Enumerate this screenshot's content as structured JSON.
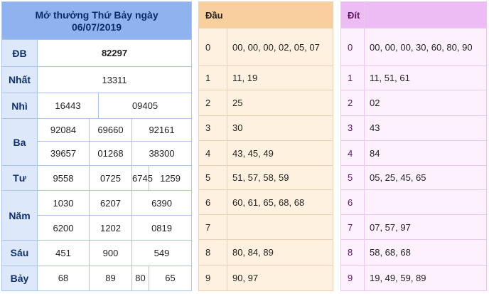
{
  "results": {
    "title_line1": "Mở thưởng Thứ Bảy ngày",
    "title_line2": "06/07/2019",
    "prizes": {
      "db": {
        "label": "ĐB",
        "values": [
          "82297"
        ]
      },
      "nhat": {
        "label": "Nhất",
        "values": [
          "13311"
        ]
      },
      "nhi": {
        "label": "Nhì",
        "values": [
          "16443",
          "09405"
        ]
      },
      "ba": {
        "label": "Ba",
        "values": [
          "92084",
          "69660",
          "92161",
          "39657",
          "01268",
          "38300"
        ]
      },
      "tu": {
        "label": "Tư",
        "values": [
          "9558",
          "0725",
          "6745",
          "1259"
        ]
      },
      "nam": {
        "label": "Năm",
        "values": [
          "1030",
          "6207",
          "6390",
          "6200",
          "1202",
          "0819"
        ]
      },
      "sau": {
        "label": "Sáu",
        "values": [
          "451",
          "900",
          "549"
        ]
      },
      "bay": {
        "label": "Bảy",
        "values": [
          "68",
          "89",
          "80",
          "65"
        ]
      }
    }
  },
  "dau": {
    "header": "Đầu",
    "rows": [
      {
        "key": "0",
        "value": "00, 00, 00, 02, 05, 07"
      },
      {
        "key": "1",
        "value": "11, 19"
      },
      {
        "key": "2",
        "value": "25"
      },
      {
        "key": "3",
        "value": "30"
      },
      {
        "key": "4",
        "value": "43, 45, 49"
      },
      {
        "key": "5",
        "value": "51, 57, 58, 59"
      },
      {
        "key": "6",
        "value": "60, 61, 65, 68, 68"
      },
      {
        "key": "7",
        "value": ""
      },
      {
        "key": "8",
        "value": "80, 84, 89"
      },
      {
        "key": "9",
        "value": "90, 97"
      }
    ]
  },
  "dit": {
    "header": "Đít",
    "rows": [
      {
        "key": "0",
        "value": "00, 00, 00, 30, 60, 80, 90"
      },
      {
        "key": "1",
        "value": "11, 51, 61"
      },
      {
        "key": "2",
        "value": "02"
      },
      {
        "key": "3",
        "value": "43"
      },
      {
        "key": "4",
        "value": "84"
      },
      {
        "key": "5",
        "value": "05, 25, 45, 65"
      },
      {
        "key": "6",
        "value": ""
      },
      {
        "key": "7",
        "value": "07, 57, 97"
      },
      {
        "key": "8",
        "value": "58, 68, 68"
      },
      {
        "key": "9",
        "value": "19, 49, 59, 89"
      }
    ]
  }
}
